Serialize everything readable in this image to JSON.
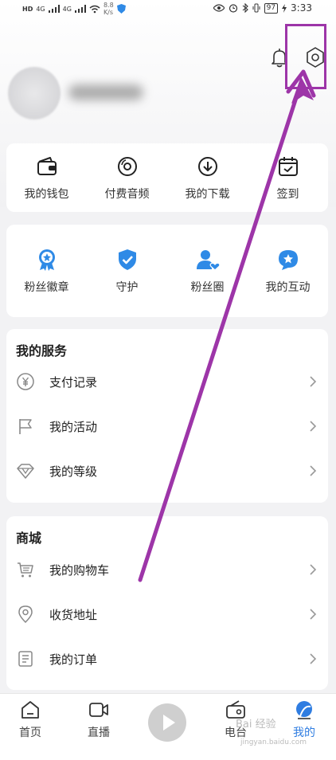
{
  "status_bar": {
    "left_labels": [
      "HD",
      "4G",
      "4G",
      "8.8",
      "K/s"
    ],
    "battery": "97",
    "time": "3:33"
  },
  "header_icons": [
    "bell-icon",
    "settings-hexagon-icon"
  ],
  "quick_actions": [
    {
      "label": "我的钱包",
      "icon": "wallet-icon"
    },
    {
      "label": "付费音频",
      "icon": "disc-icon"
    },
    {
      "label": "我的下载",
      "icon": "download-icon"
    },
    {
      "label": "签到",
      "icon": "calendar-check-icon"
    }
  ],
  "fan_actions": [
    {
      "label": "粉丝徽章",
      "icon": "medal-icon"
    },
    {
      "label": "守护",
      "icon": "shield-check-icon"
    },
    {
      "label": "粉丝圈",
      "icon": "fan-circle-icon"
    },
    {
      "label": "我的互动",
      "icon": "star-bubble-icon"
    }
  ],
  "services": {
    "title": "我的服务",
    "items": [
      {
        "label": "支付记录",
        "icon": "yen-icon"
      },
      {
        "label": "我的活动",
        "icon": "flag-icon"
      },
      {
        "label": "我的等级",
        "icon": "diamond-icon"
      }
    ]
  },
  "mall": {
    "title": "商城",
    "items": [
      {
        "label": "我的购物车",
        "icon": "cart-icon"
      },
      {
        "label": "收货地址",
        "icon": "location-icon"
      },
      {
        "label": "我的订单",
        "icon": "order-icon"
      }
    ]
  },
  "tab_bar": {
    "tabs": [
      {
        "label": "首页",
        "icon": "home-icon"
      },
      {
        "label": "直播",
        "icon": "live-camera-icon"
      },
      {
        "label": "电台",
        "icon": "radio-icon"
      },
      {
        "label": "我的",
        "icon": "profile-icon",
        "active": true
      }
    ],
    "active_color": "#2f7de1"
  },
  "watermark": {
    "text": "Bai 经验",
    "url_text": "jingyan.baidu.com"
  },
  "colors": {
    "accent": "#2f7de1",
    "annotation": "#9d35a8",
    "icon_blue": "#2f8ae6"
  }
}
